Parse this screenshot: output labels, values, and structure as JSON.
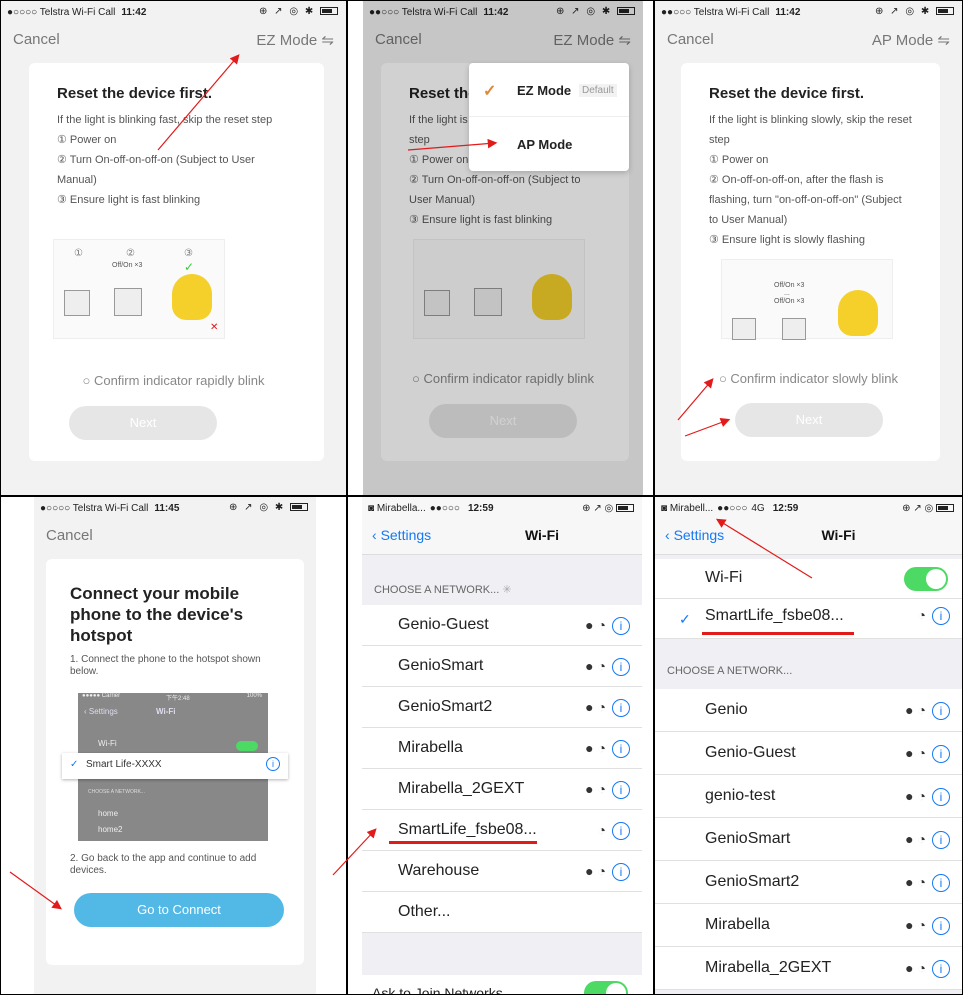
{
  "colors": {
    "accent": "#1479f6",
    "toggle": "#4cd964",
    "arrow": "#e21a1a",
    "button_blue": "#52b8e6"
  },
  "p1": {
    "status": {
      "carrier": "●○○○○ Telstra Wi-Fi Call",
      "time": "11:42",
      "icons": "⊕ ↗ ◎ ✱"
    },
    "cancel": "Cancel",
    "mode": "EZ Mode ⇋",
    "title": "Reset the device first.",
    "line1": "If the light is blinking fast, skip the reset step",
    "step1": "① Power on",
    "step2": "② Turn On-off-on-off-on (Subject to User Manual)",
    "step3": "③ Ensure light is fast blinking",
    "illus_n1": "①",
    "illus_n2": "②",
    "illus_n3": "③",
    "illus_onoff": "Off/On ×3",
    "illus_check": "✓",
    "illus_x": "✕",
    "confirm": "○ Confirm indicator rapidly blink",
    "next": "Next"
  },
  "p2": {
    "status": {
      "carrier": "●●○○○ Telstra Wi-Fi Call",
      "time": "11:42",
      "icons": "⊕ ↗ ◎ ✱"
    },
    "cancel": "Cancel",
    "mode": "EZ Mode ⇋",
    "title": "Reset the",
    "line1": "If the light is b",
    "line1b": "step",
    "step1": "① Power on",
    "step2": "② Turn On-off-on-off-on (Subject to User Manual)",
    "step3": "③ Ensure light is fast blinking",
    "dd_ez": "EZ Mode",
    "dd_default": "Default",
    "dd_ap": "AP Mode",
    "dd_check": "✓",
    "confirm": "○ Confirm indicator rapidly blink",
    "next": "Next"
  },
  "p3": {
    "status": {
      "carrier": "●●○○○ Telstra Wi-Fi Call",
      "time": "11:42",
      "icons": "⊕ ↗ ◎ ✱"
    },
    "cancel": "Cancel",
    "mode": "AP Mode ⇋",
    "title": "Reset the device first.",
    "line1": "If the light is blinking slowly, skip the reset step",
    "step1": "① Power on",
    "step2": "② On-off-on-off-on, after the flash is flashing, turn \"on-off-on-off-on\" (Subject to User Manual)",
    "step3": "③ Ensure  light is slowly flashing",
    "illus_onoff": "Off/On ×3",
    "illus_dots": "...",
    "illus_onoff2": "Off/On ×3",
    "confirm": "○ Confirm indicator slowly blink",
    "next": "Next"
  },
  "p4": {
    "status": {
      "carrier": "●○○○○ Telstra Wi-Fi Call",
      "time": "11:45",
      "icons": "⊕ ↗ ◎ ✱"
    },
    "cancel": "Cancel",
    "title": "Connect your mobile phone to the device's hotspot",
    "step1": "1. Connect the phone to the hotspot shown below.",
    "mini_carrier": "●●●●● Carrier",
    "mini_time": "下午2:48",
    "mini_battery": "100%",
    "mini_settings": "‹ Settings",
    "mini_wifi_title": "Wi-Fi",
    "mini_wifi": "Wi-Fi",
    "mini_selected": "Smart Life-XXXX",
    "mini_check": "✓",
    "mini_choose": "CHOOSE A NETWORK...",
    "mini_home": "home",
    "mini_home2": "home2",
    "step2": "2. Go back to the app and continue to add devices.",
    "button": "Go to Connect"
  },
  "p5": {
    "status": {
      "app": "◙ Mirabella...",
      "signal": "●●○○○",
      "wifi": "📶",
      "time": "12:59",
      "icons": "⊕ ↗ ◎"
    },
    "back": "Settings",
    "title": "Wi-Fi",
    "choose": "CHOOSE A NETWORK...",
    "networks": [
      "Genio-Guest",
      "GenioSmart",
      "GenioSmart2",
      "Mirabella",
      "Mirabella_2GEXT",
      "SmartLife_fsbe08...",
      "Warehouse",
      "Other..."
    ],
    "ask": "Ask to Join Networks"
  },
  "p6": {
    "status": {
      "app": "◙ Mirabell...",
      "signal": "●●○○○",
      "network": "4G",
      "time": "12:59",
      "icons": "⊕ ↗ ◎"
    },
    "back": "Settings",
    "title": "Wi-Fi",
    "wifi": "Wi-Fi",
    "connected": "SmartLife_fsbe08...",
    "check": "✓",
    "choose": "CHOOSE A NETWORK...",
    "networks": [
      "Genio",
      "Genio-Guest",
      "genio-test",
      "GenioSmart",
      "GenioSmart2",
      "Mirabella",
      "Mirabella_2GEXT"
    ]
  },
  "icons": {
    "lock": "🔒",
    "wifi": "◔",
    "info": "i",
    "back_chevron": "‹"
  }
}
